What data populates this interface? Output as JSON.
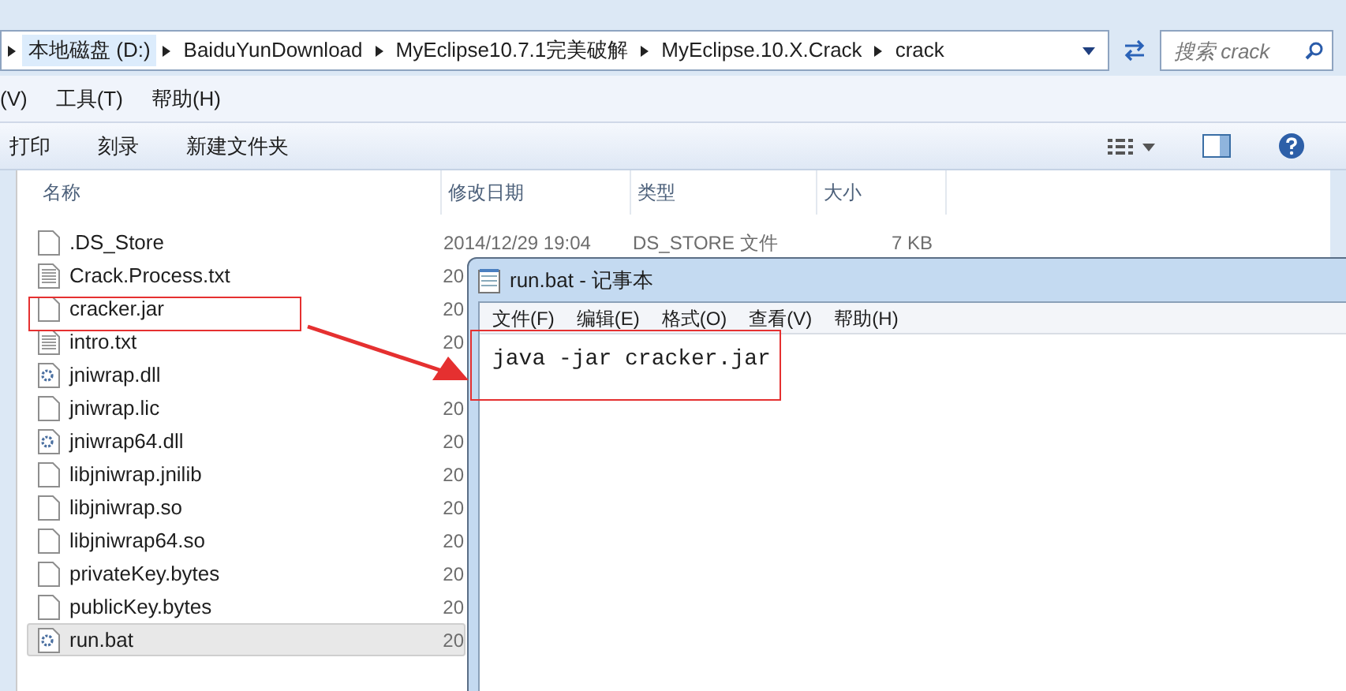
{
  "address_bar": {
    "breadcrumbs": [
      "本地磁盘 (D:)",
      "BaiduYunDownload",
      "MyEclipse10.7.1完美破解",
      "MyEclipse.10.X.Crack",
      "crack"
    ],
    "search": {
      "placeholder": "搜索 crack"
    }
  },
  "menu_bar": [
    "(V)",
    "工具(T)",
    "帮助(H)"
  ],
  "toolbar": [
    "打印",
    "刻录",
    "新建文件夹"
  ],
  "columns": [
    "名称",
    "修改日期",
    "类型",
    "大小"
  ],
  "files": [
    {
      "name": ".DS_Store",
      "kind": "blank",
      "date": "2014/12/29 19:04",
      "type": "DS_STORE 文件",
      "size": "7 KB",
      "selected": false
    },
    {
      "name": "Crack.Process.txt",
      "kind": "text",
      "date": "20",
      "selected": false
    },
    {
      "name": "cracker.jar",
      "kind": "blank",
      "date": "20",
      "selected": false
    },
    {
      "name": "intro.txt",
      "kind": "text",
      "date": "20",
      "selected": false
    },
    {
      "name": "jniwrap.dll",
      "kind": "gear",
      "selected": false
    },
    {
      "name": "jniwrap.lic",
      "kind": "blank",
      "date": "20",
      "selected": false
    },
    {
      "name": "jniwrap64.dll",
      "kind": "gear",
      "date": "20",
      "selected": false
    },
    {
      "name": "libjniwrap.jnilib",
      "kind": "blank",
      "date": "20",
      "selected": false
    },
    {
      "name": "libjniwrap.so",
      "kind": "blank",
      "date": "20",
      "selected": false
    },
    {
      "name": "libjniwrap64.so",
      "kind": "blank",
      "date": "20",
      "selected": false
    },
    {
      "name": "privateKey.bytes",
      "kind": "blank",
      "date": "20",
      "selected": false
    },
    {
      "name": "publicKey.bytes",
      "kind": "blank",
      "date": "20",
      "selected": false
    },
    {
      "name": "run.bat",
      "kind": "batch",
      "date": "20",
      "selected": true
    }
  ],
  "notepad": {
    "title": "run.bat - 记事本",
    "menu": [
      "文件(F)",
      "编辑(E)",
      "格式(O)",
      "查看(V)",
      "帮助(H)"
    ],
    "content": "java -jar cracker.jar"
  }
}
